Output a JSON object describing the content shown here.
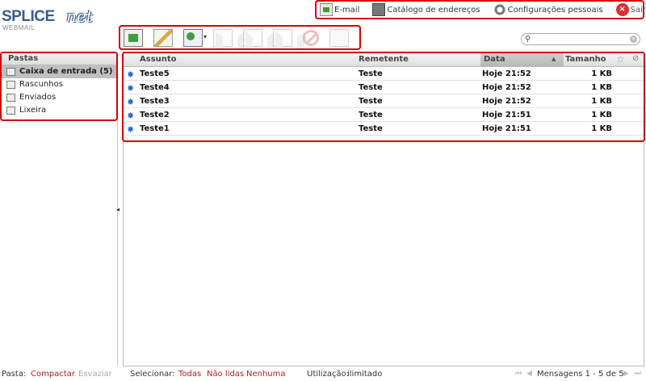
{
  "logo": {
    "main": "SPLICE",
    "script": "net",
    "sub": "WEBMAIL"
  },
  "topnav": {
    "email": "E-mail",
    "address_book": "Catálogo de endereços",
    "settings": "Configurações pessoais",
    "logout": "Sair"
  },
  "toolbar": {
    "icons": [
      "check-mail-icon",
      "compose-icon",
      "mark-read-icon",
      "reply-icon",
      "reply-all-icon",
      "forward-icon",
      "delete-icon",
      "print-icon"
    ]
  },
  "search": {
    "value": "",
    "placeholder": ""
  },
  "folders": {
    "header": "Pastas",
    "items": [
      {
        "label": "Caixa de entrada (5)",
        "icon": "inbox-icon",
        "selected": true
      },
      {
        "label": "Rascunhos",
        "icon": "drafts-icon"
      },
      {
        "label": "Enviados",
        "icon": "sent-icon"
      },
      {
        "label": "Lixeira",
        "icon": "trash-icon"
      }
    ]
  },
  "messages": {
    "columns": {
      "subject": "Assunto",
      "sender": "Remetente",
      "date": "Data",
      "size": "Tamanho"
    },
    "sort": {
      "column": "Data",
      "direction": "ascending"
    },
    "rows": [
      {
        "subject": "Teste5",
        "sender": "Teste",
        "date": "Hoje 21:52",
        "size": "1 KB"
      },
      {
        "subject": "Teste4",
        "sender": "Teste",
        "date": "Hoje 21:52",
        "size": "1 KB"
      },
      {
        "subject": "Teste3",
        "sender": "Teste",
        "date": "Hoje 21:52",
        "size": "1 KB"
      },
      {
        "subject": "Teste2",
        "sender": "Teste",
        "date": "Hoje 21:51",
        "size": "1 KB"
      },
      {
        "subject": "Teste1",
        "sender": "Teste",
        "date": "Hoje 21:51",
        "size": "1 KB"
      }
    ]
  },
  "footer": {
    "folder_label": "Pasta:",
    "compact": "Compactar",
    "empty": "Esvaziar",
    "select_label": "Selecionar:",
    "select_all": "Todas",
    "select_unread": "Não lidas",
    "select_none": "Nenhuma",
    "usage_label": "Utilização:",
    "usage_value": "ilimitado",
    "pagination": "Mensagens 1 - 5 de 5"
  },
  "colors": {
    "highlight_border": "#d40000",
    "link": "#b02020",
    "logo_blue": "#3a5c8c",
    "unread_dot": "#2a6ad4"
  }
}
